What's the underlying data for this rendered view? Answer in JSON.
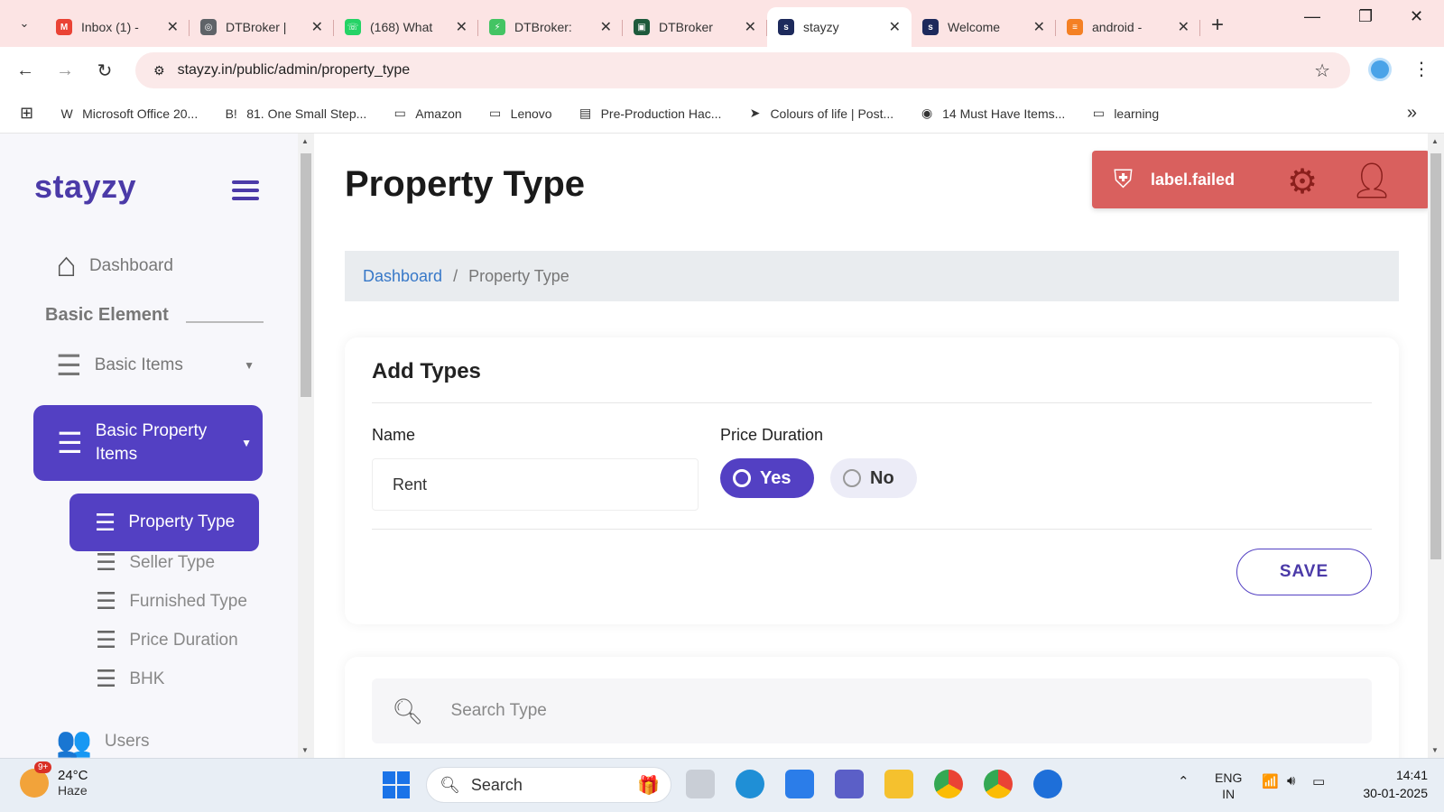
{
  "browser": {
    "tabs": [
      {
        "title": "Inbox (1) -",
        "fav_color": "#ea4335",
        "fav_glyph": "M",
        "active": false
      },
      {
        "title": "DTBroker |",
        "fav_color": "#5f6368",
        "fav_glyph": "◎",
        "active": false
      },
      {
        "title": "(168) What",
        "fav_color": "#25d366",
        "fav_glyph": "☏",
        "active": false
      },
      {
        "title": "DTBroker:",
        "fav_color": "#43c463",
        "fav_glyph": "⚡",
        "active": false
      },
      {
        "title": "DTBroker",
        "fav_color": "#1e5a3c",
        "fav_glyph": "▣",
        "active": false
      },
      {
        "title": "stayzy",
        "fav_color": "#1d2a5c",
        "fav_glyph": "s",
        "active": true
      },
      {
        "title": "Welcome",
        "fav_color": "#1d2a5c",
        "fav_glyph": "s",
        "active": false
      },
      {
        "title": "android -",
        "fav_color": "#f48024",
        "fav_glyph": "≡",
        "active": false
      }
    ],
    "url": "stayzy.in/public/admin/property_type",
    "bookmarks": [
      {
        "label": "Microsoft Office 20...",
        "icon": "W"
      },
      {
        "label": "81. One Small Step...",
        "icon": "B!"
      },
      {
        "label": "Amazon",
        "icon": "▭"
      },
      {
        "label": "Lenovo",
        "icon": "▭"
      },
      {
        "label": "Pre-Production Hac...",
        "icon": "▤"
      },
      {
        "label": "Colours of life | Post...",
        "icon": "➤"
      },
      {
        "label": "14 Must Have Items...",
        "icon": "◉"
      },
      {
        "label": "learning",
        "icon": "▭"
      }
    ]
  },
  "sidebar": {
    "logo": "stayzy",
    "dashboard": "Dashboard",
    "section": "Basic Element",
    "basic_items": "Basic Items",
    "basic_property_items": "Basic Property Items",
    "sub_items": [
      "Property Type",
      "Seller Type",
      "Furnished Type",
      "Price Duration",
      "BHK"
    ],
    "users": "Users"
  },
  "main": {
    "title": "Property Type",
    "breadcrumb": {
      "home": "Dashboard",
      "current": "Property Type"
    },
    "form": {
      "heading": "Add Types",
      "name_label": "Name",
      "name_value": "Rent",
      "price_duration_label": "Price Duration",
      "yes": "Yes",
      "no": "No",
      "selected": "Yes",
      "save": "SAVE"
    },
    "search_placeholder": "Search Type",
    "alert": "label.failed"
  },
  "colors": {
    "primary": "#5340c3",
    "alert": "#d9605e",
    "link": "#3778c8"
  },
  "taskbar": {
    "temp": "24°C",
    "condition": "Haze",
    "badge": "9+",
    "search": "Search",
    "lang1": "ENG",
    "lang2": "IN",
    "time": "14:41",
    "date": "30-01-2025"
  }
}
